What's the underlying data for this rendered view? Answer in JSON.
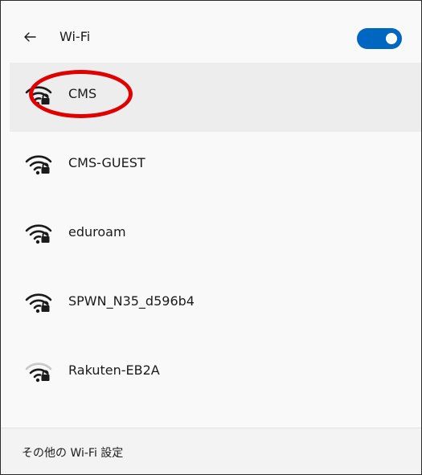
{
  "header": {
    "back_icon": "arrow-left-icon",
    "title": "Wi-Fi",
    "toggle_on": true,
    "toggle_color": "#0067c0"
  },
  "networks": [
    {
      "ssid": "CMS",
      "secured": true,
      "selected": true
    },
    {
      "ssid": "CMS-GUEST",
      "secured": true
    },
    {
      "ssid": "eduroam",
      "secured": true
    },
    {
      "ssid": "SPWN_N35_d596b4",
      "secured": true
    },
    {
      "ssid": "Rakuten-EB2A",
      "secured": true
    }
  ],
  "footer": {
    "link_label": "その他の Wi-Fi 設定"
  },
  "annotation": {
    "shape": "ellipse",
    "color": "#e10000",
    "target": "CMS"
  }
}
